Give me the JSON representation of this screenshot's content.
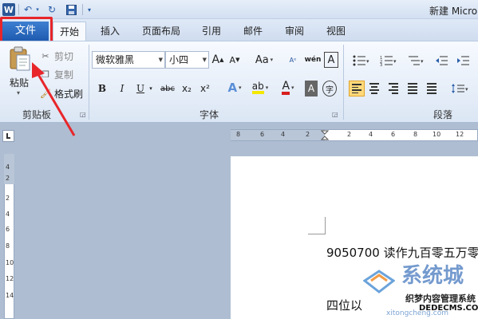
{
  "app": {
    "logo_letter": "W",
    "document_title": "新建 Micro"
  },
  "quick_access": {
    "undo_icon": "↶",
    "redo_icon": "↻",
    "save_icon": "▣",
    "dropdown_icon": "▾"
  },
  "tabs": {
    "file": "文件",
    "home": "开始",
    "insert": "插入",
    "page_layout": "页面布局",
    "references": "引用",
    "mailings": "邮件",
    "review": "审阅",
    "view": "视图"
  },
  "clipboard": {
    "paste": "粘贴",
    "cut": "剪切",
    "copy": "复制",
    "format_painter": "格式刷",
    "group_label": "剪贴板"
  },
  "font": {
    "name": "微软雅黑",
    "size": "小四",
    "grow": "A",
    "shrink": "A",
    "case": "Aa",
    "bold": "B",
    "italic": "I",
    "underline": "U",
    "strike": "abc",
    "subscript": "x₂",
    "superscript": "x²",
    "group_label": "字体"
  },
  "paragraph": {
    "group_label": "段落"
  },
  "ruler": {
    "h_ticks": [
      "8",
      "6",
      "4",
      "2",
      "2",
      "4",
      "6",
      "8",
      "10",
      "12"
    ],
    "v_ticks": [
      "4",
      "2",
      "2",
      "4",
      "6",
      "8",
      "10",
      "12",
      "14"
    ]
  },
  "document": {
    "line1": "9050700 读作九百零五万零",
    "line2": "四位以"
  },
  "watermark": {
    "brand": "系统城",
    "line1": "织梦内容管理系统",
    "line2": "DEDECMS.COM",
    "url": "xitongcheng.com"
  },
  "colors": {
    "file_tab": "#2b6cc4",
    "highlight": "#e8262a",
    "arrow": "#e8262a",
    "font_color": "#d81e1e",
    "highlight_color": "#f5e800"
  }
}
